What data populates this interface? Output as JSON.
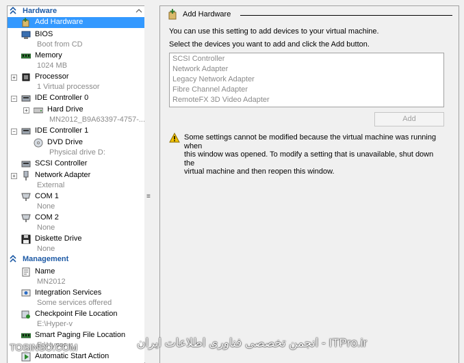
{
  "hardware_section": {
    "title": "Hardware"
  },
  "management_section": {
    "title": "Management"
  },
  "tree_items": [
    {
      "id": "add-hardware",
      "label": "Add Hardware",
      "sub": "",
      "icon": "add-hardware-icon",
      "expander": ""
    },
    {
      "id": "bios",
      "label": "BIOS",
      "sub": "Boot from CD",
      "icon": "bios-icon",
      "expander": ""
    },
    {
      "id": "memory",
      "label": "Memory",
      "sub": "1024 MB",
      "icon": "memory-icon",
      "expander": ""
    },
    {
      "id": "processor",
      "label": "Processor",
      "sub": "1 Virtual processor",
      "icon": "processor-icon",
      "expander": "+"
    },
    {
      "id": "ide-controller-0",
      "label": "IDE Controller 0",
      "sub": "",
      "icon": "ide-controller-icon",
      "expander": "−"
    },
    {
      "id": "hard-drive",
      "label": "Hard Drive",
      "sub": "MN2012_B9A63397-4757-...",
      "icon": "hard-drive-icon",
      "expander": "+"
    },
    {
      "id": "ide-controller-1",
      "label": "IDE Controller 1",
      "sub": "",
      "icon": "ide-controller-icon",
      "expander": "−"
    },
    {
      "id": "dvd-drive",
      "label": "DVD Drive",
      "sub": "Physical drive D:",
      "icon": "dvd-drive-icon",
      "expander": ""
    },
    {
      "id": "scsi-controller",
      "label": "SCSI Controller",
      "sub": "",
      "icon": "scsi-controller-icon",
      "expander": ""
    },
    {
      "id": "network-adapter",
      "label": "Network Adapter",
      "sub": "External",
      "icon": "network-adapter-icon",
      "expander": "+"
    },
    {
      "id": "com1",
      "label": "COM 1",
      "sub": "None",
      "icon": "com-port-icon",
      "expander": ""
    },
    {
      "id": "com2",
      "label": "COM 2",
      "sub": "None",
      "icon": "com-port-icon",
      "expander": ""
    },
    {
      "id": "diskette-drive",
      "label": "Diskette Drive",
      "sub": "None",
      "icon": "diskette-icon",
      "expander": ""
    },
    {
      "id": "name",
      "label": "Name",
      "sub": "MN2012",
      "icon": "name-icon",
      "expander": ""
    },
    {
      "id": "integration-services",
      "label": "Integration Services",
      "sub": "Some services offered",
      "icon": "integration-services-icon",
      "expander": ""
    },
    {
      "id": "checkpoint-file-location",
      "label": "Checkpoint File Location",
      "sub": "E:\\Hyper-v",
      "icon": "checkpoint-icon",
      "expander": ""
    },
    {
      "id": "smart-paging-file-location",
      "label": "Smart Paging File Location",
      "sub": "E:\\Hyper-v",
      "icon": "smart-paging-icon",
      "expander": ""
    },
    {
      "id": "automatic-start-action",
      "label": "Automatic Start Action",
      "sub": "",
      "icon": "automatic-start-icon",
      "expander": ""
    }
  ],
  "detail": {
    "title": "Add Hardware",
    "intro": "You can use this setting to add devices to your virtual machine.",
    "instruction": "Select the devices you want to add and click the Add button.",
    "devices": [
      "SCSI Controller",
      "Network Adapter",
      "Legacy Network Adapter",
      "Fibre Channel Adapter",
      "RemoteFX 3D Video Adapter"
    ],
    "add_label": "Add",
    "warning_lines": [
      "Some settings cannot be modified because the virtual machine was running when",
      "this window was opened. To modify a setting that is unavailable, shut down the",
      "virtual machine and then reopen this window."
    ]
  },
  "watermark": {
    "left": "TOSINSO.COM",
    "right": "ITPro.ir - انجمن تخصصی فناوری اطلاعات ایران"
  },
  "colors": {
    "section_header": "#1d5aa5",
    "selection": "#3399ff",
    "muted_text": "#8a8a8a",
    "warning": "#f2c200"
  }
}
